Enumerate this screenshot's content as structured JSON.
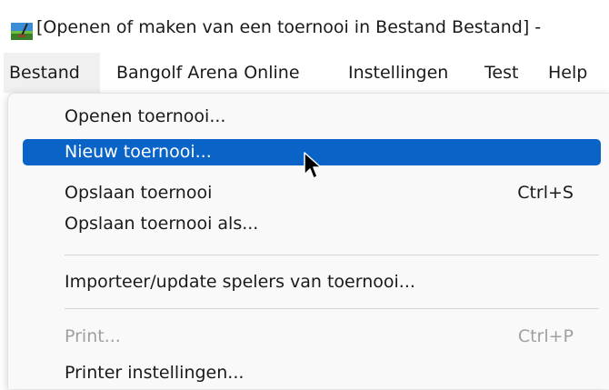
{
  "window": {
    "title": "[Openen of maken van een toernooi in Bestand Bestand] -",
    "icon": "app-logo-icon"
  },
  "menubar": {
    "items": [
      {
        "label": "Bestand",
        "active": true
      },
      {
        "label": "Bangolf Arena Online"
      },
      {
        "label": "Instellingen"
      },
      {
        "label": "Test"
      },
      {
        "label": "Help"
      }
    ]
  },
  "menu": {
    "items": [
      {
        "label": "Openen toernooi...",
        "shortcut": ""
      },
      {
        "label": "Nieuw toernooi...",
        "shortcut": "",
        "highlighted": true
      },
      {
        "label": "Opslaan toernooi",
        "shortcut": "Ctrl+S"
      },
      {
        "label": "Opslaan toernooi als...",
        "shortcut": ""
      },
      {
        "label": "Importeer/update spelers van toernooi...",
        "shortcut": ""
      },
      {
        "label": "Print...",
        "shortcut": "Ctrl+P",
        "disabled": true
      },
      {
        "label": "Printer instellingen...",
        "shortcut": ""
      }
    ]
  },
  "colors": {
    "highlight": "#0a64c8",
    "disabled_text": "#a0a0a0",
    "menu_background": "#f9f9f9"
  },
  "cursor": {
    "icon": "arrow-cursor-icon"
  }
}
